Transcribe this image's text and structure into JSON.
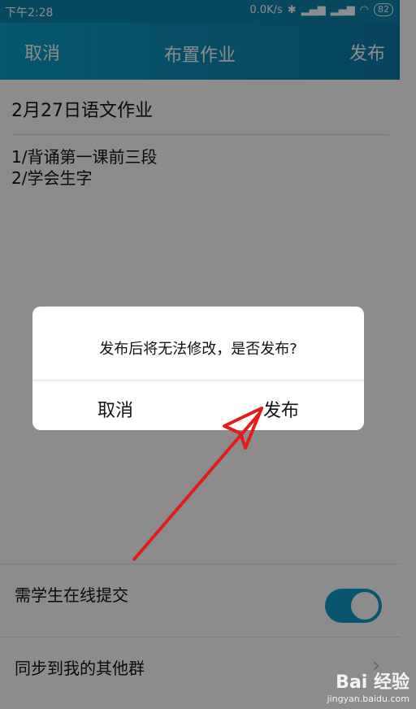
{
  "status_bar": {
    "time": "下午2:28",
    "net_speed": "0.0K/s",
    "battery": "82"
  },
  "app_bar": {
    "left": "取消",
    "title": "布置作业",
    "right": "发布"
  },
  "homework": {
    "title": "2月27日语文作业",
    "line1": "1/背诵第一课前三段",
    "line2": "2/学会生字"
  },
  "options": {
    "online_submit": "需学生在线提交",
    "sync_groups": "同步到我的其他群"
  },
  "dialog": {
    "message": "发布后将无法修改，是否发布?",
    "cancel": "取消",
    "confirm": "发布"
  },
  "watermark": {
    "main": "Bai 经验",
    "sub": "jingyan.baidu.com"
  },
  "colors": {
    "accent": "#0aa0c9",
    "arrow": "#e21b1b"
  }
}
